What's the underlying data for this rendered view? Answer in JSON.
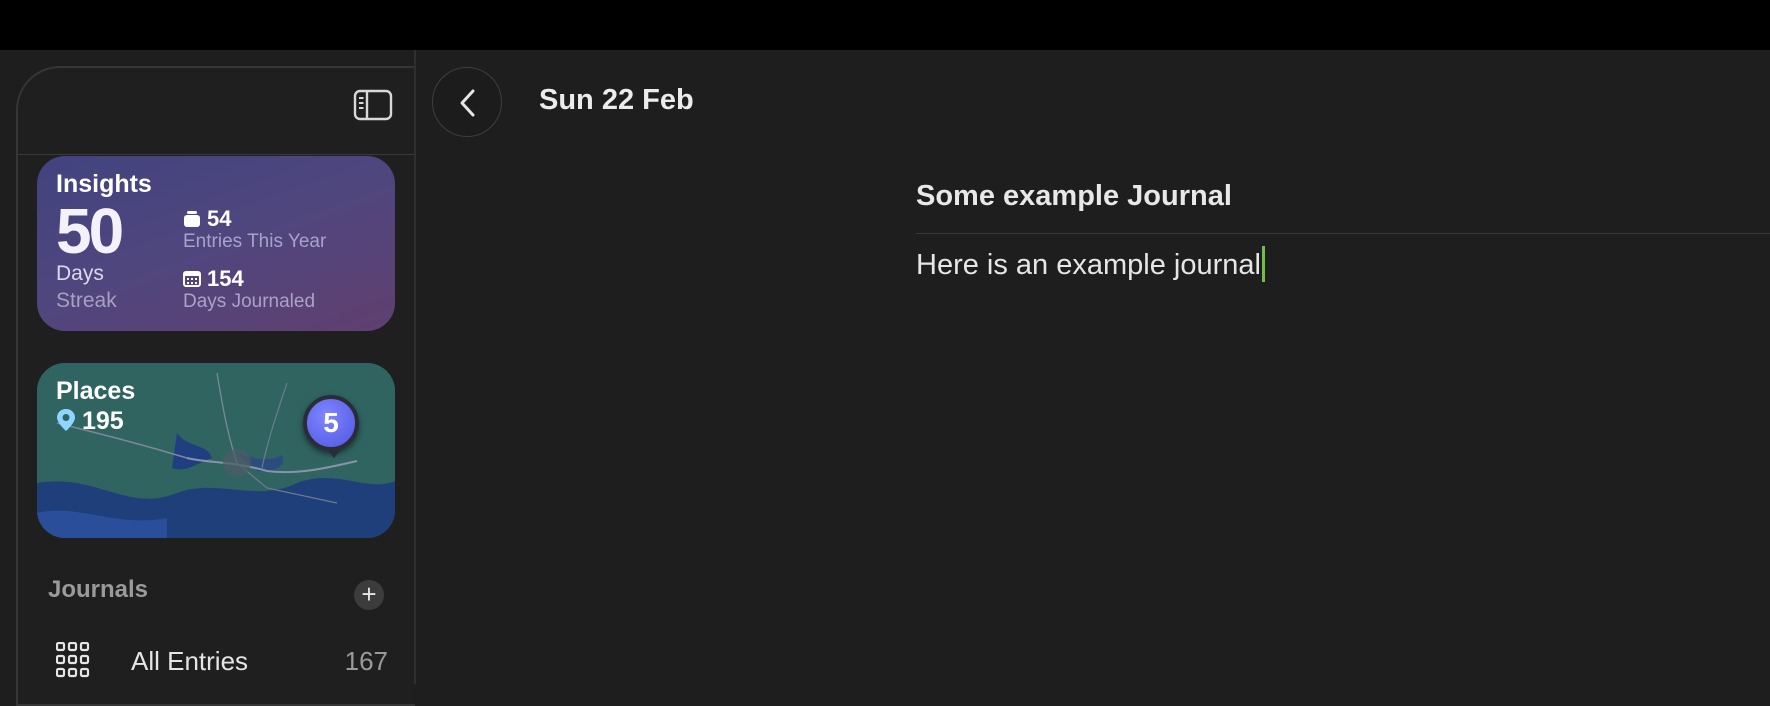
{
  "insights": {
    "title": "Insights",
    "streak_value": "50",
    "streak_unit": "Days",
    "streak_label": "Streak",
    "entries_value": "54",
    "entries_label": "Entries This Year",
    "days_value": "154",
    "days_label": "Days Journaled",
    "colors": {
      "start": "#41437f",
      "end": "#603f6f"
    }
  },
  "places": {
    "title": "Places",
    "count": "195",
    "pin_badge": "5",
    "pin_color": "#5b63f0"
  },
  "journals": {
    "heading": "Journals",
    "add_icon": "plus-icon",
    "items": [
      {
        "label": "All Entries",
        "count": "167",
        "icon": "grid-icon"
      }
    ]
  },
  "header": {
    "date": "Sun 22 Feb",
    "back_icon": "chevron-left-icon",
    "sidebar_toggle_icon": "sidebar-icon"
  },
  "entry": {
    "title": "Some example Journal",
    "body": "Here is an example journal",
    "caret_color": "#6fbf4a"
  }
}
